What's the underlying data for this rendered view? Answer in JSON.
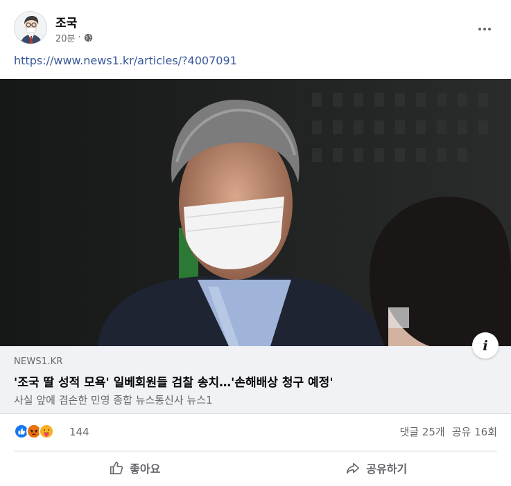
{
  "post": {
    "author": "조국",
    "time": "20분",
    "separator": "·",
    "link_text": "https://www.news1.kr/articles/?4007091"
  },
  "icons": {
    "privacy": "globe-icon",
    "more": "more-options-icon",
    "info": "info-icon",
    "like": "like-icon",
    "share": "share-icon"
  },
  "link_preview": {
    "domain": "NEWS1.KR",
    "title": "'조국 딸 성적 모욕' 일베회원들 검찰 송치…'손해배상 청구 예정'",
    "description": "사실 앞에 겸손한 민영 종합 뉴스통신사 뉴스1"
  },
  "engagement": {
    "reaction_types": [
      "like",
      "angry",
      "care"
    ],
    "reaction_count": "144",
    "comments": "댓글 25개",
    "shares": "공유 16회"
  },
  "actions": {
    "like_label": "좋아요",
    "share_label": "공유하기"
  },
  "colors": {
    "link": "#385898",
    "secondary_text": "#65676b",
    "preview_background": "#f0f2f5",
    "like_blue": "#1877f2",
    "angry_orange": "#e9710f",
    "care_yellow": "#f7b125"
  }
}
